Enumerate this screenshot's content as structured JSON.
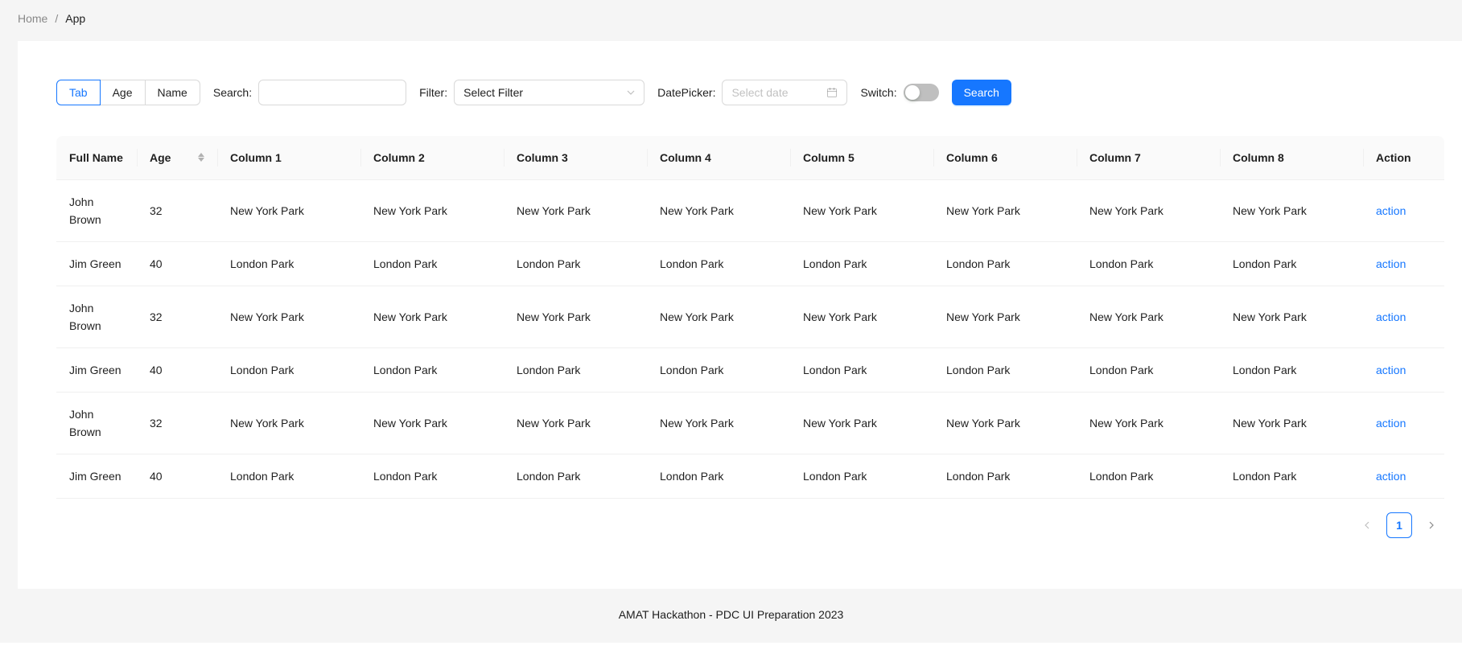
{
  "breadcrumb": {
    "home": "Home",
    "separator": "/",
    "current": "App"
  },
  "toolbar": {
    "segments": [
      "Tab",
      "Age",
      "Name"
    ],
    "active_segment": "Tab",
    "search_label": "Search:",
    "search_value": "",
    "filter_label": "Filter:",
    "filter_value": "Select Filter",
    "datepicker_label": "DatePicker:",
    "datepicker_placeholder": "Select date",
    "switch_label": "Switch:",
    "switch_on": false,
    "search_button": "Search"
  },
  "table": {
    "columns": [
      "Full Name",
      "Age",
      "Column 1",
      "Column 2",
      "Column 3",
      "Column 4",
      "Column 5",
      "Column 6",
      "Column 7",
      "Column 8",
      "Action"
    ],
    "rows": [
      {
        "name": "John\nBrown",
        "age": "32",
        "cells": [
          "New York Park",
          "New York Park",
          "New York Park",
          "New York Park",
          "New York Park",
          "New York Park",
          "New York Park",
          "New York Park"
        ],
        "action": "action"
      },
      {
        "name": "Jim Green",
        "age": "40",
        "cells": [
          "London Park",
          "London Park",
          "London Park",
          "London Park",
          "London Park",
          "London Park",
          "London Park",
          "London Park"
        ],
        "action": "action"
      },
      {
        "name": "John\nBrown",
        "age": "32",
        "cells": [
          "New York Park",
          "New York Park",
          "New York Park",
          "New York Park",
          "New York Park",
          "New York Park",
          "New York Park",
          "New York Park"
        ],
        "action": "action"
      },
      {
        "name": "Jim Green",
        "age": "40",
        "cells": [
          "London Park",
          "London Park",
          "London Park",
          "London Park",
          "London Park",
          "London Park",
          "London Park",
          "London Park"
        ],
        "action": "action"
      },
      {
        "name": "John\nBrown",
        "age": "32",
        "cells": [
          "New York Park",
          "New York Park",
          "New York Park",
          "New York Park",
          "New York Park",
          "New York Park",
          "New York Park",
          "New York Park"
        ],
        "action": "action"
      },
      {
        "name": "Jim Green",
        "age": "40",
        "cells": [
          "London Park",
          "London Park",
          "London Park",
          "London Park",
          "London Park",
          "London Park",
          "London Park",
          "London Park"
        ],
        "action": "action"
      }
    ]
  },
  "pagination": {
    "current_page": "1",
    "prev_icon": "chevron-left-icon",
    "next_icon": "chevron-right-icon"
  },
  "footer": {
    "text": "AMAT Hackathon - PDC UI Preparation 2023"
  },
  "colors": {
    "primary": "#1677ff",
    "background": "#f5f5f5",
    "header_bg": "#fafafa"
  }
}
